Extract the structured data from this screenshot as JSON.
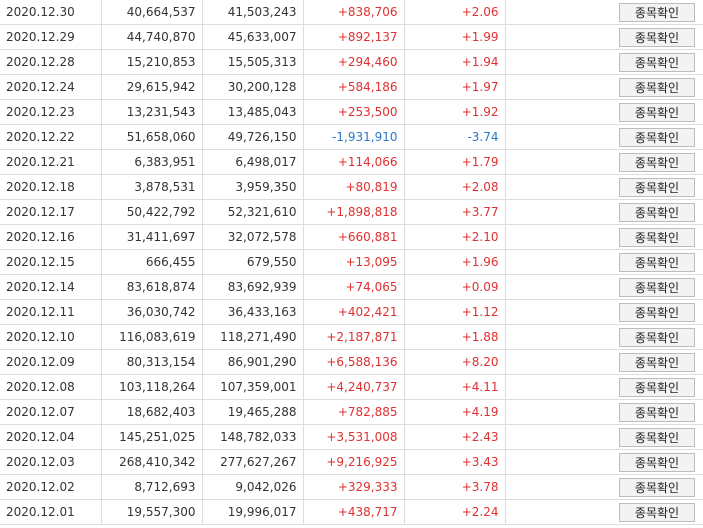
{
  "colors": {
    "up": "#e03030",
    "down": "#2a78c8",
    "border": "#dddddd",
    "button_bg": "#f3f3f3"
  },
  "button_label": "종목확인",
  "rows": [
    {
      "date": "2020.12.30",
      "col1": "40,664,537",
      "col2": "41,503,243",
      "change": "+838,706",
      "pct": "+2.06",
      "dir": "up"
    },
    {
      "date": "2020.12.29",
      "col1": "44,740,870",
      "col2": "45,633,007",
      "change": "+892,137",
      "pct": "+1.99",
      "dir": "up"
    },
    {
      "date": "2020.12.28",
      "col1": "15,210,853",
      "col2": "15,505,313",
      "change": "+294,460",
      "pct": "+1.94",
      "dir": "up"
    },
    {
      "date": "2020.12.24",
      "col1": "29,615,942",
      "col2": "30,200,128",
      "change": "+584,186",
      "pct": "+1.97",
      "dir": "up"
    },
    {
      "date": "2020.12.23",
      "col1": "13,231,543",
      "col2": "13,485,043",
      "change": "+253,500",
      "pct": "+1.92",
      "dir": "up"
    },
    {
      "date": "2020.12.22",
      "col1": "51,658,060",
      "col2": "49,726,150",
      "change": "-1,931,910",
      "pct": "-3.74",
      "dir": "down"
    },
    {
      "date": "2020.12.21",
      "col1": "6,383,951",
      "col2": "6,498,017",
      "change": "+114,066",
      "pct": "+1.79",
      "dir": "up"
    },
    {
      "date": "2020.12.18",
      "col1": "3,878,531",
      "col2": "3,959,350",
      "change": "+80,819",
      "pct": "+2.08",
      "dir": "up"
    },
    {
      "date": "2020.12.17",
      "col1": "50,422,792",
      "col2": "52,321,610",
      "change": "+1,898,818",
      "pct": "+3.77",
      "dir": "up"
    },
    {
      "date": "2020.12.16",
      "col1": "31,411,697",
      "col2": "32,072,578",
      "change": "+660,881",
      "pct": "+2.10",
      "dir": "up"
    },
    {
      "date": "2020.12.15",
      "col1": "666,455",
      "col2": "679,550",
      "change": "+13,095",
      "pct": "+1.96",
      "dir": "up"
    },
    {
      "date": "2020.12.14",
      "col1": "83,618,874",
      "col2": "83,692,939",
      "change": "+74,065",
      "pct": "+0.09",
      "dir": "up"
    },
    {
      "date": "2020.12.11",
      "col1": "36,030,742",
      "col2": "36,433,163",
      "change": "+402,421",
      "pct": "+1.12",
      "dir": "up"
    },
    {
      "date": "2020.12.10",
      "col1": "116,083,619",
      "col2": "118,271,490",
      "change": "+2,187,871",
      "pct": "+1.88",
      "dir": "up"
    },
    {
      "date": "2020.12.09",
      "col1": "80,313,154",
      "col2": "86,901,290",
      "change": "+6,588,136",
      "pct": "+8.20",
      "dir": "up"
    },
    {
      "date": "2020.12.08",
      "col1": "103,118,264",
      "col2": "107,359,001",
      "change": "+4,240,737",
      "pct": "+4.11",
      "dir": "up"
    },
    {
      "date": "2020.12.07",
      "col1": "18,682,403",
      "col2": "19,465,288",
      "change": "+782,885",
      "pct": "+4.19",
      "dir": "up"
    },
    {
      "date": "2020.12.04",
      "col1": "145,251,025",
      "col2": "148,782,033",
      "change": "+3,531,008",
      "pct": "+2.43",
      "dir": "up"
    },
    {
      "date": "2020.12.03",
      "col1": "268,410,342",
      "col2": "277,627,267",
      "change": "+9,216,925",
      "pct": "+3.43",
      "dir": "up"
    },
    {
      "date": "2020.12.02",
      "col1": "8,712,693",
      "col2": "9,042,026",
      "change": "+329,333",
      "pct": "+3.78",
      "dir": "up"
    },
    {
      "date": "2020.12.01",
      "col1": "19,557,300",
      "col2": "19,996,017",
      "change": "+438,717",
      "pct": "+2.24",
      "dir": "up"
    }
  ]
}
